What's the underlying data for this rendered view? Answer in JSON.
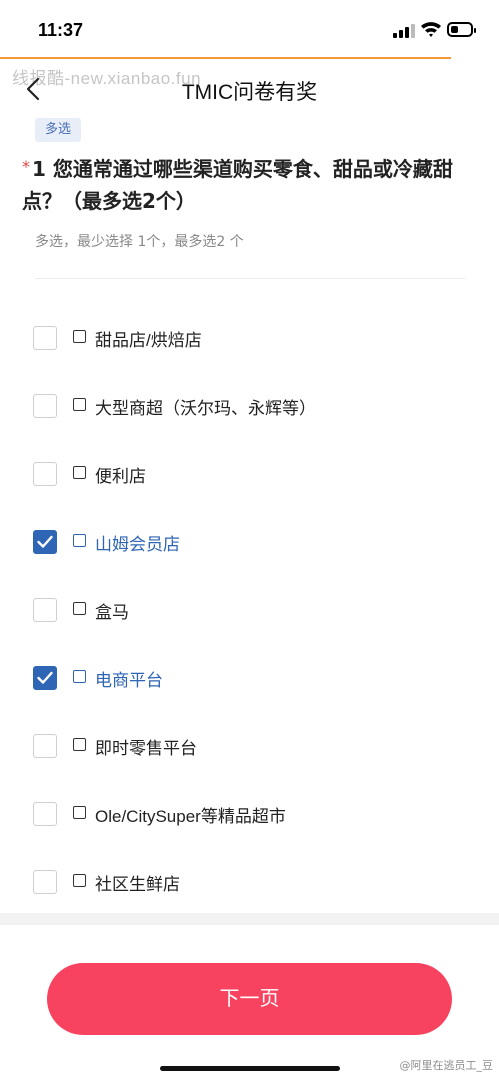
{
  "status_bar": {
    "time": "11:37",
    "signal_icon": "cellular-signal-icon",
    "wifi_icon": "wifi-icon",
    "battery_icon": "battery-low-icon"
  },
  "nav": {
    "title": "TMIC问卷有奖",
    "back_icon": "chevron-left-icon",
    "watermark": "线报酷-new.xianbao.fun"
  },
  "question": {
    "type_tag": "多选",
    "required_mark": "*",
    "title": "1 您通常通过哪些渠道购买零食、甜品或冷藏甜点？（最多选2个）",
    "hint": "多选，最少选择 1个，最多选2 个"
  },
  "options": [
    {
      "label": "甜品店/烘焙店",
      "checked": false
    },
    {
      "label": "大型商超（沃尔玛、永辉等）",
      "checked": false
    },
    {
      "label": "便利店",
      "checked": false
    },
    {
      "label": "山姆会员店",
      "checked": true
    },
    {
      "label": "盒马",
      "checked": false
    },
    {
      "label": "电商平台",
      "checked": true
    },
    {
      "label": "即时零售平台",
      "checked": false
    },
    {
      "label": "Ole/CitySuper等精品超市",
      "checked": false
    },
    {
      "label": "社区生鲜店",
      "checked": false
    }
  ],
  "footer": {
    "next_label": "下一页",
    "credit": "@阿里在逃员工_豆"
  },
  "colors": {
    "accent": "#2f65b5",
    "button": "#f7435f",
    "progress": "#f39a37",
    "required": "#e54545"
  }
}
